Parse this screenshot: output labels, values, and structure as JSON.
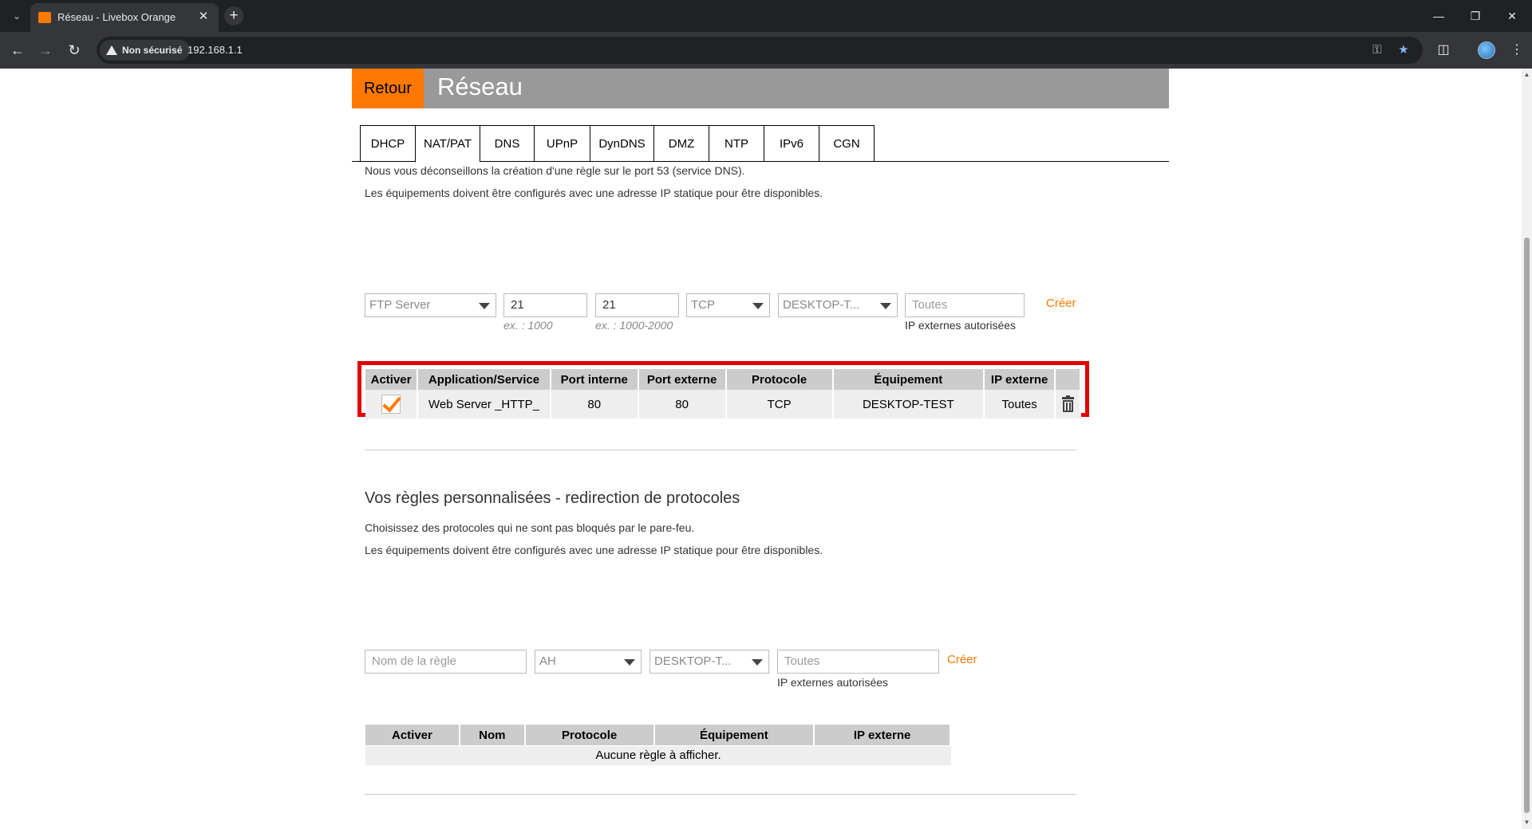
{
  "browser": {
    "tab_title": "Réseau - Livebox Orange",
    "security_label": "Non sécurisé",
    "url": "192.168.1.1"
  },
  "page": {
    "back_label": "Retour",
    "title": "Réseau"
  },
  "tabs": [
    "DHCP",
    "NAT/PAT",
    "DNS",
    "UPnP",
    "DynDNS",
    "DMZ",
    "NTP",
    "IPv6",
    "CGN"
  ],
  "active_tab": "NAT/PAT",
  "nat": {
    "info1": "Nous vous déconseillons la création d'une règle sur le port 53 (service DNS).",
    "info2": "Les équipements doivent être configurés avec une adresse IP statique pour être disponibles.",
    "form": {
      "service_value": "FTP Server",
      "port_internal_value": "21",
      "port_internal_hint": "ex. : 1000",
      "port_external_value": "21",
      "port_external_hint": "ex. : 1000-2000",
      "protocol_value": "TCP",
      "device_value": "DESKTOP-T...",
      "external_ip_placeholder": "Toutes",
      "external_ip_hint": "IP externes autorisées",
      "create_label": "Créer"
    },
    "table": {
      "headers": [
        "Activer",
        "Application/Service",
        "Port interne",
        "Port externe",
        "Protocole",
        "Équipement",
        "IP externe",
        ""
      ],
      "rows": [
        {
          "enabled": true,
          "service": "Web Server _HTTP_",
          "port_internal": "80",
          "port_external": "80",
          "protocol": "TCP",
          "device": "DESKTOP-TEST",
          "external_ip": "Toutes"
        }
      ]
    }
  },
  "protocols": {
    "title": "Vos règles personnalisées - redirection de protocoles",
    "info1": "Choisissez des protocoles qui ne sont pas bloqués par le pare-feu.",
    "info2": "Les équipements doivent être configurés avec une adresse IP statique pour être disponibles.",
    "form": {
      "rule_name_placeholder": "Nom de la règle",
      "protocol_value": "AH",
      "device_value": "DESKTOP-T...",
      "external_ip_placeholder": "Toutes",
      "external_ip_hint": "IP externes autorisées",
      "create_label": "Créer"
    },
    "table": {
      "headers": [
        "Activer",
        "Nom",
        "Protocole",
        "Équipement",
        "IP externe"
      ],
      "empty_message": "Aucune règle à afficher."
    }
  },
  "colors": {
    "accent": "#ff7900",
    "highlight": "#e00000",
    "header_gray": "#999999"
  }
}
